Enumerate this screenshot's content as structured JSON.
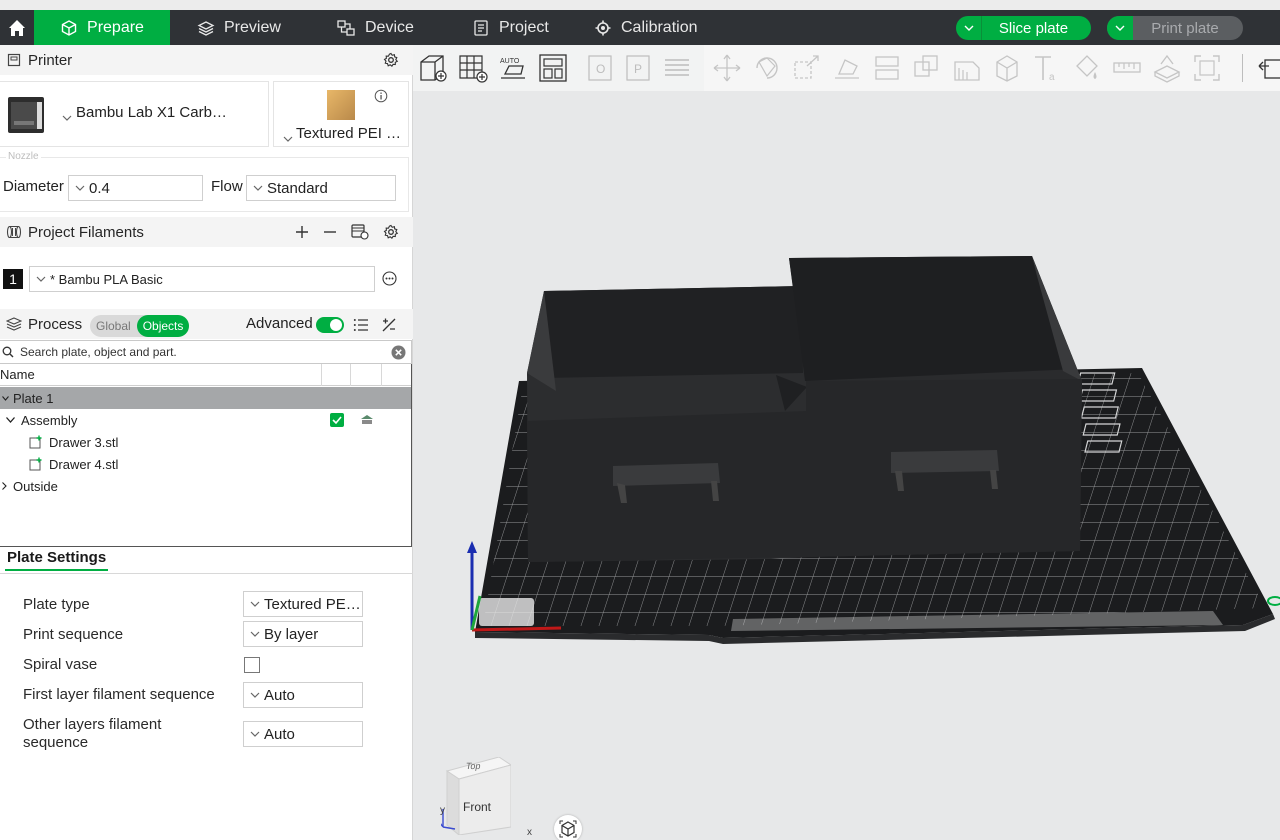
{
  "nav": {
    "tabs": [
      {
        "label": "Prepare",
        "icon": "cube-icon"
      },
      {
        "label": "Preview",
        "icon": "layers-icon"
      },
      {
        "label": "Device",
        "icon": "device-icon"
      },
      {
        "label": "Project",
        "icon": "project-icon"
      },
      {
        "label": "Calibration",
        "icon": "calibration-icon"
      }
    ],
    "active_tab": "Prepare",
    "slice_label": "Slice plate",
    "print_label": "Print plate",
    "accent": "#00ae42"
  },
  "printer": {
    "section_title": "Printer",
    "name": "Bambu Lab X1 Carb…",
    "plate_name": "Textured PEI …",
    "nozzle_title": "Nozzle",
    "diameter_label": "Diameter",
    "diameter_value": "0.4",
    "flow_label": "Flow",
    "flow_value": "Standard"
  },
  "filaments": {
    "section_title": "Project Filaments",
    "items": [
      {
        "index": "1",
        "name": "* Bambu PLA Basic"
      }
    ]
  },
  "process": {
    "section_title": "Process",
    "seg_global": "Global",
    "seg_objects": "Objects",
    "active_seg": "Objects",
    "advanced_label": "Advanced",
    "advanced_on": true
  },
  "search": {
    "placeholder": "Search plate, object and part."
  },
  "tree": {
    "column_name": "Name",
    "rows": [
      {
        "label": "Plate 1",
        "level": 0,
        "selected": true
      },
      {
        "label": "Assembly",
        "level": 1
      },
      {
        "label": "Drawer 3.stl",
        "level": 2
      },
      {
        "label": "Drawer 4.stl",
        "level": 2
      },
      {
        "label": "Outside",
        "level": 0
      }
    ]
  },
  "plate_settings": {
    "tab_label": "Plate Settings",
    "plate_type_label": "Plate type",
    "plate_type_value": "Textured PE…",
    "print_sequence_label": "Print sequence",
    "print_sequence_value": "By layer",
    "spiral_vase_label": "Spiral vase",
    "spiral_vase_checked": false,
    "first_layer_label": "First layer filament sequence",
    "first_layer_value": "Auto",
    "other_layers_label_1": "Other layers filament",
    "other_layers_label_2": "sequence",
    "other_layers_value": "Auto"
  },
  "viewport": {
    "view_cube_front": "Front",
    "view_cube_top": "Top",
    "axis_x": "x",
    "axis_y": "y"
  }
}
